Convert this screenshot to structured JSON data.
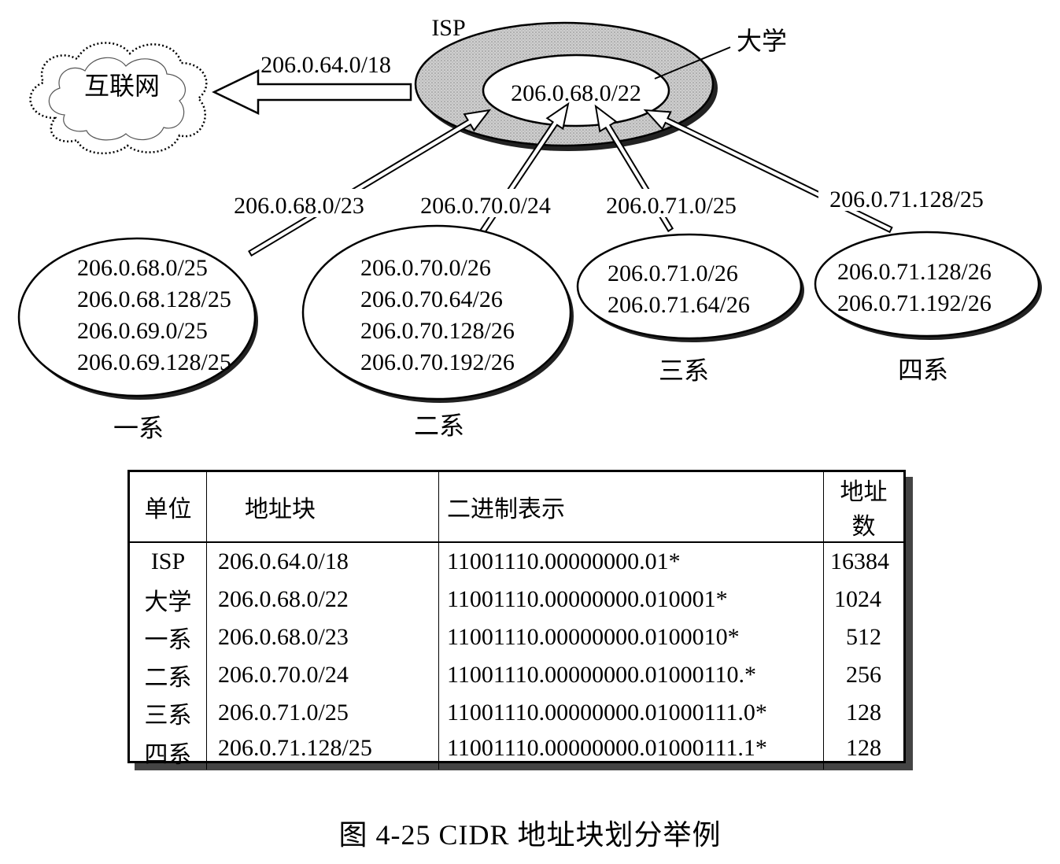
{
  "diagram": {
    "isp_label": "ISP",
    "university_label": "大学",
    "internet_label": "互联网",
    "internet_route": "206.0.64.0/18",
    "university_block": "206.0.68.0/22",
    "departments": [
      {
        "name": "一系",
        "route": "206.0.68.0/23",
        "subnets": [
          "206.0.68.0/25",
          "206.0.68.128/25",
          "206.0.69.0/25",
          "206.0.69.128/25"
        ]
      },
      {
        "name": "二系",
        "route": "206.0.70.0/24",
        "subnets": [
          "206.0.70.0/26",
          "206.0.70.64/26",
          "206.0.70.128/26",
          "206.0.70.192/26"
        ]
      },
      {
        "name": "三系",
        "route": "206.0.71.0/25",
        "subnets": [
          "206.0.71.0/26",
          "206.0.71.64/26"
        ]
      },
      {
        "name": "四系",
        "route": "206.0.71.128/25",
        "subnets": [
          "206.0.71.128/26",
          "206.0.71.192/26"
        ]
      }
    ]
  },
  "table": {
    "headers": [
      "单位",
      "地址块",
      "二进制表示",
      "地址数"
    ],
    "rows": [
      [
        "ISP",
        "206.0.64.0/18",
        "11001110.00000000.01*",
        "16384"
      ],
      [
        "大学",
        "206.0.68.0/22",
        "11001110.00000000.010001*",
        "1024"
      ],
      [
        "一系",
        "206.0.68.0/23",
        "11001110.00000000.0100010*",
        "512"
      ],
      [
        "二系",
        "206.0.70.0/24",
        "11001110.00000000.01000110.*",
        "256"
      ],
      [
        "三系",
        "206.0.71.0/25",
        "11001110.00000000.01000111.0*",
        "128"
      ],
      [
        "四系",
        "206.0.71.128/25",
        "11001110.00000000.01000111.1*",
        "128"
      ]
    ]
  },
  "caption": "图 4-25    CIDR 地址块划分举例",
  "colors": {
    "isp_ring": "#c6c6c6",
    "line": "#000000",
    "shadow": "#444444"
  }
}
